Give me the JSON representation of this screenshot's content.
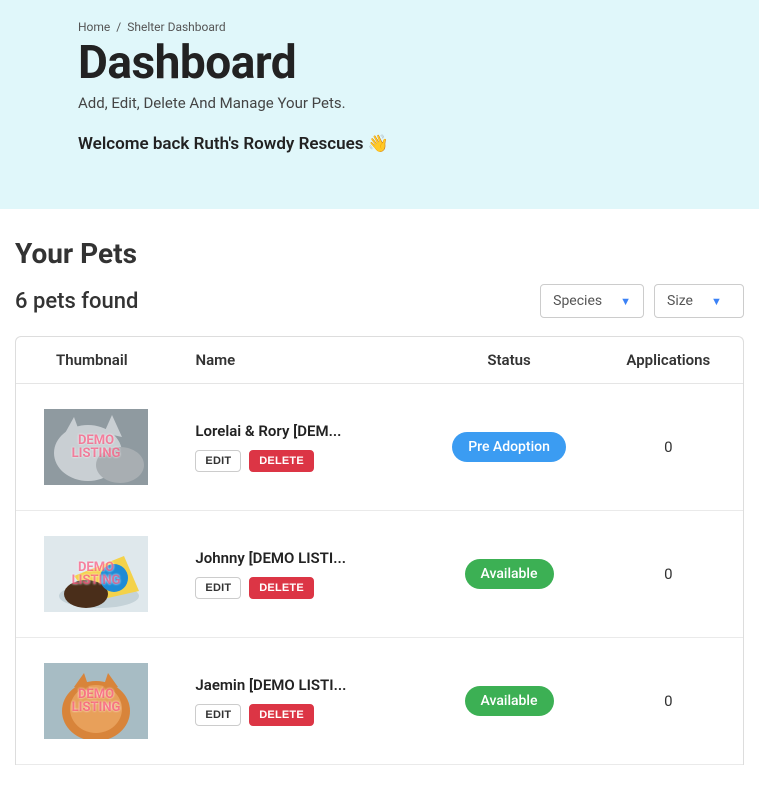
{
  "breadcrumb": {
    "home": "Home",
    "sep": "/",
    "current": "Shelter Dashboard"
  },
  "header": {
    "title": "Dashboard",
    "subtitle": "Add, Edit, Delete And Manage Your Pets.",
    "welcome": "Welcome back Ruth's Rowdy Rescues",
    "wave": "👋"
  },
  "section": {
    "title": "Your Pets",
    "count_label": "6 pets found"
  },
  "filters": {
    "species": "Species",
    "size": "Size"
  },
  "columns": {
    "thumbnail": "Thumbnail",
    "name": "Name",
    "status": "Status",
    "applications": "Applications"
  },
  "buttons": {
    "edit": "EDIT",
    "delete": "DELETE"
  },
  "status_styles": {
    "Pre Adoption": "#3b9cf2",
    "Available": "#3cb054"
  },
  "thumb_watermark": "DEMO\nLISTING",
  "pets": [
    {
      "name": "Lorelai & Rory [DEM...",
      "status": "Pre Adoption",
      "applications": "0",
      "thumb_variant": "fluffy"
    },
    {
      "name": "Johnny [DEMO LISTI...",
      "status": "Available",
      "applications": "0",
      "thumb_variant": "cone"
    },
    {
      "name": "Jaemin [DEMO LISTI...",
      "status": "Available",
      "applications": "0",
      "thumb_variant": "orange"
    }
  ]
}
